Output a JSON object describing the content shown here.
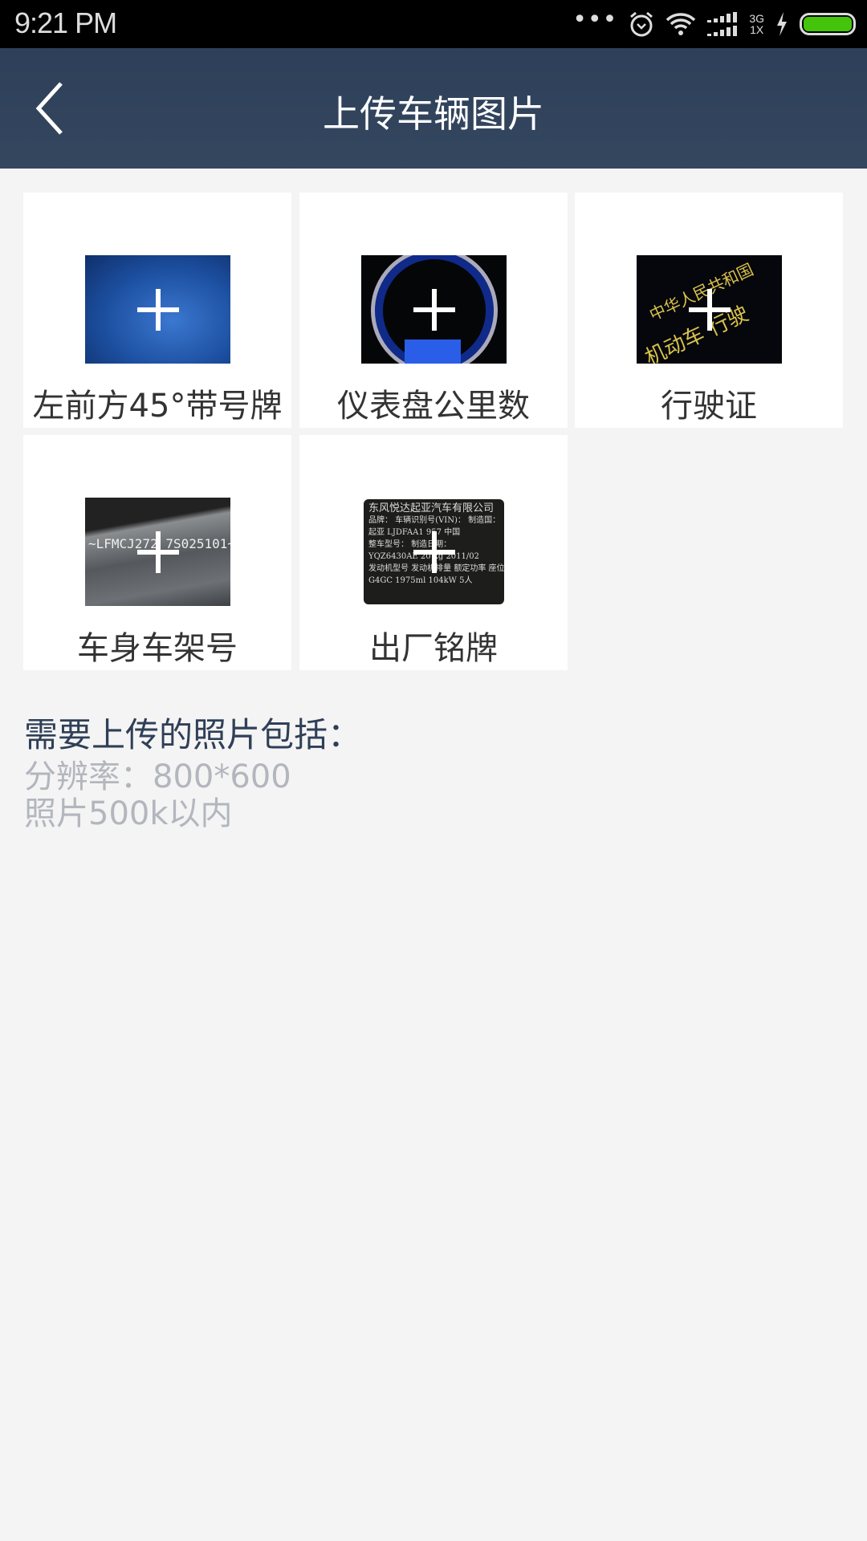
{
  "status_bar": {
    "time": "9:21 PM",
    "network_top": "3G",
    "network_bottom": "1X",
    "icons": [
      "more-dots-icon",
      "alarm-icon",
      "wifi-icon",
      "signal-icon",
      "charging-icon",
      "battery-icon"
    ],
    "battery_color": "#44c40a"
  },
  "header": {
    "title": "上传车辆图片",
    "back_icon": "chevron-left-icon",
    "background": "#2f4159"
  },
  "tiles": [
    {
      "label": "左前方45°带号牌"
    },
    {
      "label": "仪表盘公里数"
    },
    {
      "label": "行驶证",
      "sample_text_1": "中华人民共和国",
      "sample_text_2": "机动车 行驶"
    },
    {
      "label": "车身车架号",
      "sample_text": "~LFMCJ272 7S025101~"
    },
    {
      "label": "出厂铭牌",
      "sample_lines": [
        "东风悦达起亚汽车有限公司",
        "品牌： 车辆识别号(VIN)： 制造国：",
        "起亚 LJDFAA1 957 中国",
        "整车型号： 制造日期：",
        "YQZ6430AE 20 kg 2011/02",
        "发动机型号 发动机排量 额定功率 座位数",
        "G4GC 1975ml 104kW 5人"
      ]
    }
  ],
  "info": {
    "heading": "需要上传的照片包括：",
    "lines": [
      "分辨率：800*600",
      "照片500k以内"
    ]
  }
}
